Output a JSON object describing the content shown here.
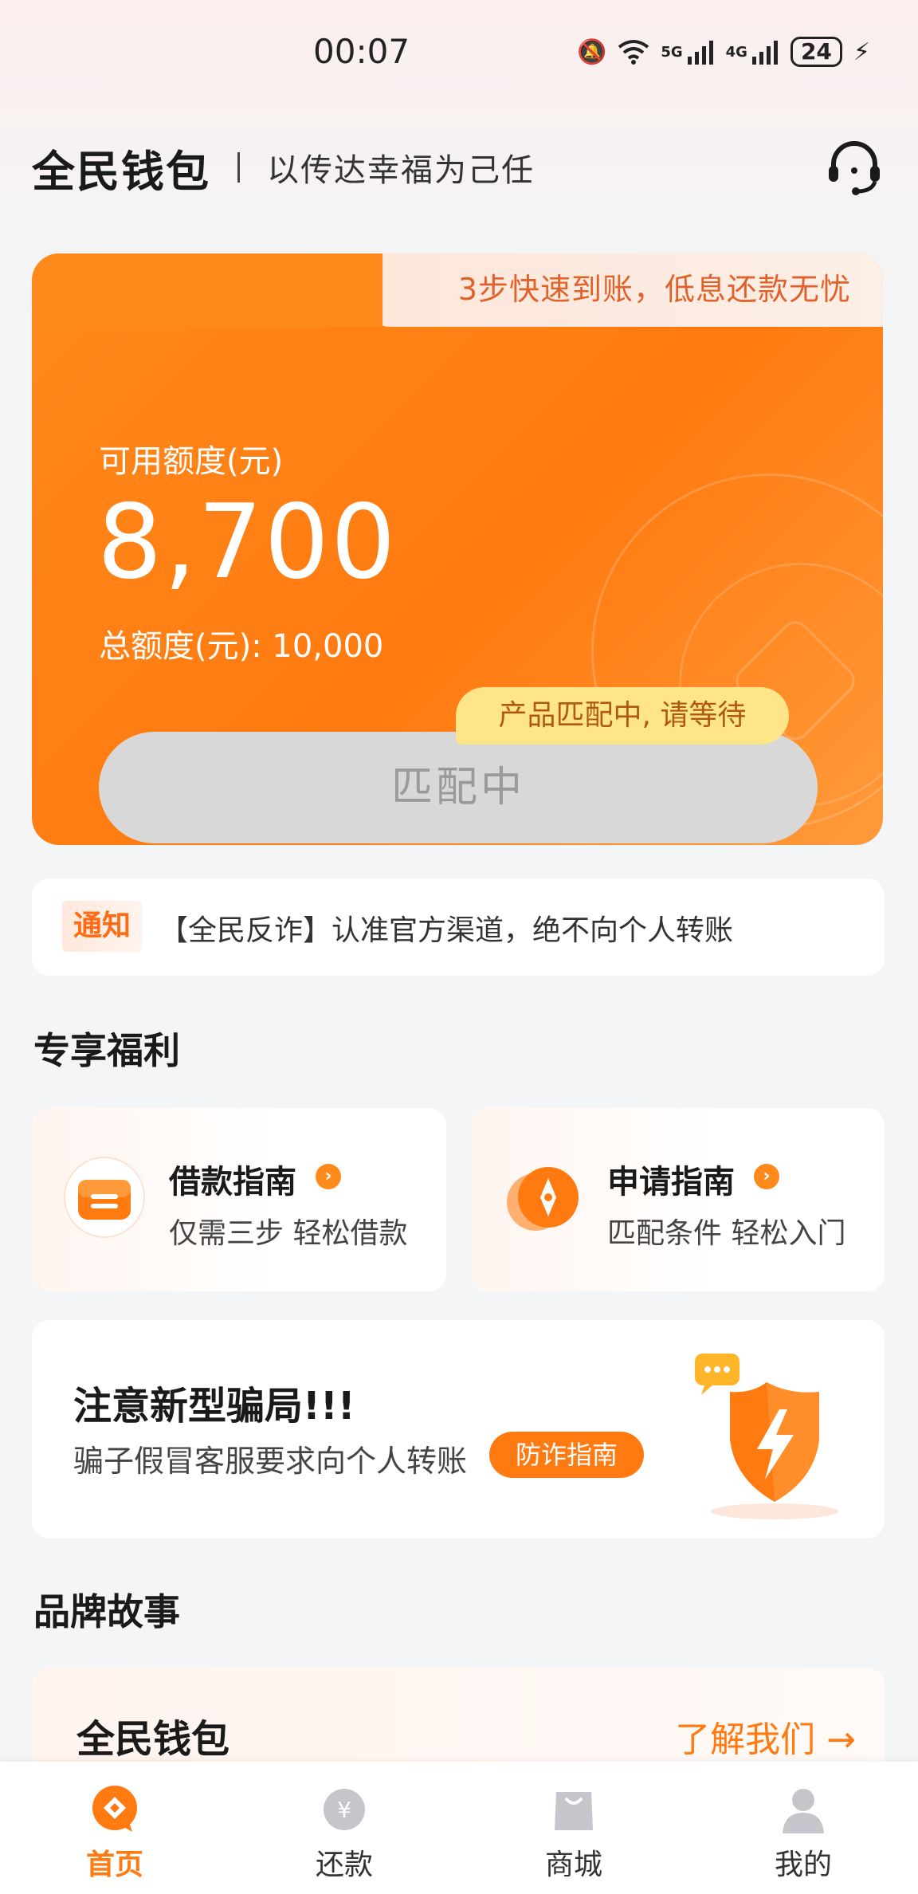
{
  "status_bar": {
    "time": "00:07",
    "battery": "24",
    "signal_labels": [
      "5G",
      "4G"
    ]
  },
  "header": {
    "brand": "全民钱包",
    "slogan": "以传达幸福为己任"
  },
  "credit_card": {
    "tab_text": "3步快速到账，低息还款无忧",
    "available_label": "可用额度(元)",
    "available_amount": "8,700",
    "total_text": "总额度(元): 10,000",
    "match_button": "匹配中",
    "match_bubble": "产品匹配中, 请等待"
  },
  "notice": {
    "tag": "通知",
    "text": "【全民反诈】认准官方渠道，绝不向个人转账"
  },
  "benefits": {
    "title": "专享福利",
    "items": [
      {
        "title": "借款指南",
        "subtitle": "仅需三步 轻松借款",
        "icon": "loan-guide-icon"
      },
      {
        "title": "申请指南",
        "subtitle": "匹配条件 轻松入门",
        "icon": "compass-icon"
      }
    ]
  },
  "fraud_banner": {
    "title": "注意新型骗局!!!",
    "subtitle": "骗子假冒客服要求向个人转账",
    "button": "防诈指南"
  },
  "brand_story": {
    "title": "品牌故事",
    "card_title": "全民钱包",
    "link": "了解我们 →"
  },
  "bottom_nav": {
    "items": [
      {
        "label": "首页",
        "icon": "home-icon",
        "active": true
      },
      {
        "label": "还款",
        "icon": "repay-icon",
        "active": false
      },
      {
        "label": "商城",
        "icon": "shop-bag-icon",
        "active": false
      },
      {
        "label": "我的",
        "icon": "profile-icon",
        "active": false
      }
    ]
  },
  "colors": {
    "accent": "#ff7a10",
    "card_gradient_start": "#ff8a1c",
    "bubble": "#ffe58a",
    "button_disabled": "#d8d8d8"
  }
}
